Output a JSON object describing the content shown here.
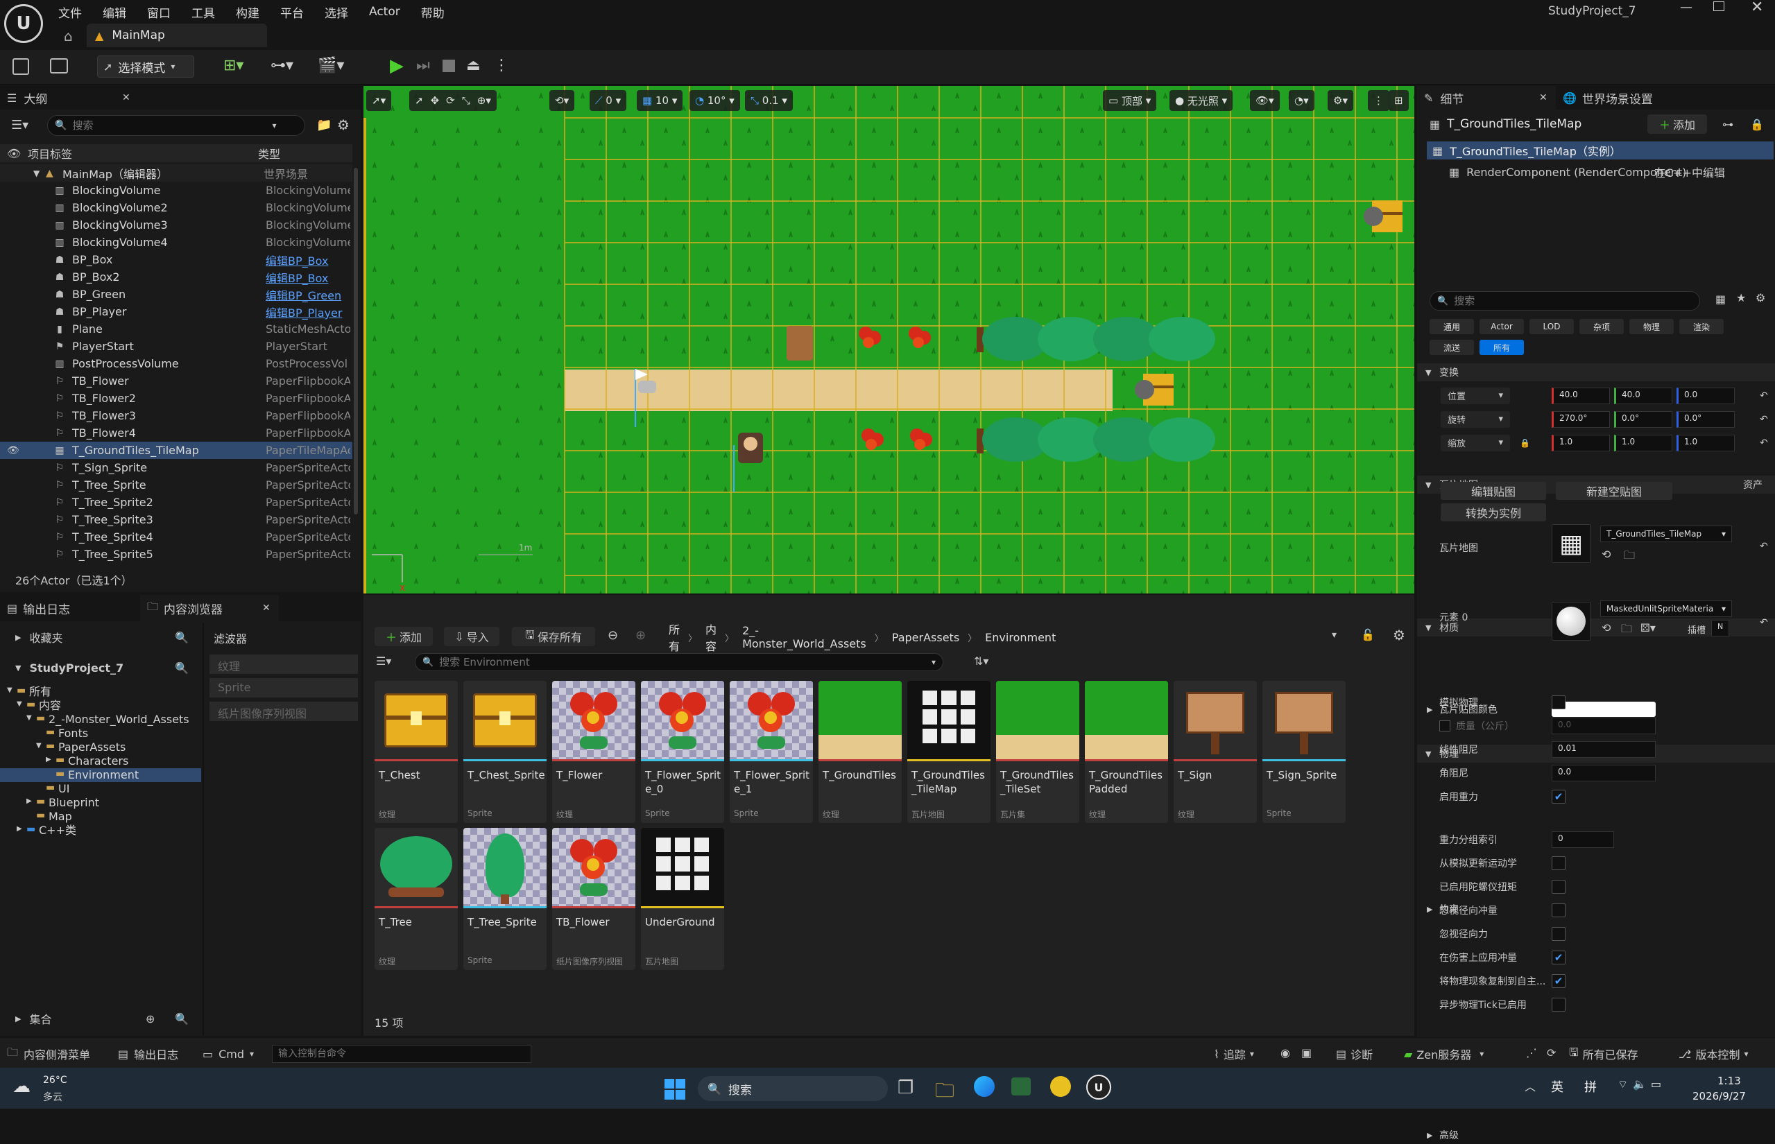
{
  "title_bar": {
    "menu": [
      "文件",
      "编辑",
      "窗口",
      "工具",
      "构建",
      "平台",
      "选择",
      "Actor",
      "帮助"
    ],
    "project_name": "StudyProject_7",
    "level_tab": "MainMap"
  },
  "toolbar": {
    "mode": "选择模式"
  },
  "outliner": {
    "tab": "大纲",
    "search_placeholder": "搜索",
    "col_label": "项目标签",
    "col_type": "类型",
    "root": {
      "label": "MainMap（编辑器）",
      "type": "世界场景"
    },
    "items": [
      {
        "label": "BlockingVolume",
        "type": "BlockingVolume",
        "link": false
      },
      {
        "label": "BlockingVolume2",
        "type": "BlockingVolume",
        "link": false
      },
      {
        "label": "BlockingVolume3",
        "type": "BlockingVolume",
        "link": false
      },
      {
        "label": "BlockingVolume4",
        "type": "BlockingVolume",
        "link": false
      },
      {
        "label": "BP_Box",
        "type": "编辑BP_Box",
        "link": true
      },
      {
        "label": "BP_Box2",
        "type": "编辑BP_Box",
        "link": true
      },
      {
        "label": "BP_Green",
        "type": "编辑BP_Green",
        "link": true
      },
      {
        "label": "BP_Player",
        "type": "编辑BP_Player",
        "link": true
      },
      {
        "label": "Plane",
        "type": "StaticMeshActo",
        "link": false
      },
      {
        "label": "PlayerStart",
        "type": "PlayerStart",
        "link": false
      },
      {
        "label": "PostProcessVolume",
        "type": "PostProcessVol",
        "link": false
      },
      {
        "label": "TB_Flower",
        "type": "PaperFlipbookA",
        "link": false
      },
      {
        "label": "TB_Flower2",
        "type": "PaperFlipbookA",
        "link": false
      },
      {
        "label": "TB_Flower3",
        "type": "PaperFlipbookA",
        "link": false
      },
      {
        "label": "TB_Flower4",
        "type": "PaperFlipbookA",
        "link": false
      },
      {
        "label": "T_GroundTiles_TileMap",
        "type": "PaperTileMapAc",
        "link": false
      },
      {
        "label": "T_Sign_Sprite",
        "type": "PaperSpriteActo",
        "link": false
      },
      {
        "label": "T_Tree_Sprite",
        "type": "PaperSpriteActo",
        "link": false
      },
      {
        "label": "T_Tree_Sprite2",
        "type": "PaperSpriteActo",
        "link": false
      },
      {
        "label": "T_Tree_Sprite3",
        "type": "PaperSpriteActo",
        "link": false
      },
      {
        "label": "T_Tree_Sprite4",
        "type": "PaperSpriteActo",
        "link": false
      },
      {
        "label": "T_Tree_Sprite5",
        "type": "PaperSpriteActo",
        "link": false
      }
    ],
    "footer": "26个Actor（已选1个）"
  },
  "viewport": {
    "snap_rot": "0",
    "grid": "10",
    "angle": "10°",
    "scale": "0.1",
    "view": "顶部",
    "lighting": "无光照",
    "scale_label": "1m"
  },
  "details": {
    "tab_details": "细节",
    "tab_world": "世界场景设置",
    "actor_name": "T_GroundTiles_TileMap",
    "add_label": "添加",
    "instance": "T_GroundTiles_TileMap（实例）",
    "component": "RenderComponent (RenderComponent)",
    "component_link": "在C++中编辑",
    "search_placeholder": "搜索",
    "filters": [
      "通用",
      "Actor",
      "LOD",
      "杂项",
      "物理",
      "渲染",
      "流送",
      "所有"
    ],
    "section_transform": "变换",
    "location_label": "位置",
    "rotation_label": "旋转",
    "scale_label": "缩放",
    "location": [
      "40.0",
      "40.0",
      "0.0"
    ],
    "rotation": [
      "270.0°",
      "0.0°",
      "0.0°"
    ],
    "scale": [
      "1.0",
      "1.0",
      "1.0"
    ],
    "section_tilemap": "瓦片地图",
    "asset_label": "资产",
    "btn_edit": "编辑贴图",
    "btn_new": "新建空贴图",
    "btn_convert": "转换为实例",
    "tilemap_label": "瓦片地图",
    "tilemap_value": "T_GroundTiles_TileMap",
    "section_material": "材质",
    "element0": "元素 0",
    "material_value": "MaskedUnlitSpriteMateria",
    "slot_label": "插槽",
    "slot_value": "N",
    "tile_color_label": "瓦片贴图颜色",
    "section_physics": "物理",
    "physics": [
      {
        "label": "模拟物理",
        "kind": "check",
        "checked": false
      },
      {
        "label": "质量（公斤）",
        "kind": "mass",
        "value": "0.0"
      },
      {
        "label": "线性阻尼",
        "kind": "num",
        "value": "0.01"
      },
      {
        "label": "角阻尼",
        "kind": "num",
        "value": "0.0"
      },
      {
        "label": "启用重力",
        "kind": "check",
        "checked": true
      }
    ],
    "section_constraints": "约束",
    "more": [
      {
        "label": "重力分组索引",
        "kind": "num",
        "value": "0"
      },
      {
        "label": "从模拟更新运动学",
        "kind": "check",
        "checked": false
      },
      {
        "label": "已启用陀螺仪扭矩",
        "kind": "check",
        "checked": false
      },
      {
        "label": "忽视径向冲量",
        "kind": "check",
        "checked": false
      },
      {
        "label": "忽视径向力",
        "kind": "check",
        "checked": false
      },
      {
        "label": "在伤害上应用冲量",
        "kind": "check",
        "checked": true
      },
      {
        "label": "将物理现象复制到自主...",
        "kind": "check",
        "checked": true
      },
      {
        "label": "异步物理Tick已启用",
        "kind": "check",
        "checked": false
      }
    ],
    "section_advanced": "高级"
  },
  "bottom_tabs": {
    "output_log": "输出日志",
    "content_browser": "内容浏览器"
  },
  "sources": {
    "favorites": "收藏夹",
    "project": "StudyProject_7",
    "tree": [
      {
        "label": "所有",
        "indent": 0
      },
      {
        "label": "内容",
        "indent": 1
      },
      {
        "label": "2_-Monster_World_Assets",
        "indent": 2
      },
      {
        "label": "Fonts",
        "indent": 3
      },
      {
        "label": "PaperAssets",
        "indent": 3
      },
      {
        "label": "Characters",
        "indent": 4
      },
      {
        "label": "Environment",
        "indent": 4
      },
      {
        "label": "UI",
        "indent": 3
      },
      {
        "label": "Blueprint",
        "indent": 2
      },
      {
        "label": "Map",
        "indent": 2
      },
      {
        "label": "C++类",
        "indent": 1
      }
    ],
    "collections": "集合",
    "filters_title": "滤波器",
    "filters": [
      "纹理",
      "Sprite",
      "纸片图像序列视图"
    ]
  },
  "content_browser": {
    "add": "添加",
    "import": "导入",
    "save_all": "保存所有",
    "path": [
      "所有",
      "内容",
      "2_-Monster_World_Assets",
      "PaperAssets",
      "Environment"
    ],
    "search_placeholder": "搜索 Environment",
    "count": "15 项",
    "assets": [
      {
        "name": "T_Chest",
        "type": "纹理",
        "thumb": "chest"
      },
      {
        "name": "T_Chest_Sprite",
        "type": "Sprite",
        "thumb": "chest"
      },
      {
        "name": "T_Flower",
        "type": "纹理",
        "thumb": "flower2"
      },
      {
        "name": "T_Flower_Sprite_0",
        "type": "Sprite",
        "thumb": "flower"
      },
      {
        "name": "T_Flower_Sprite_1",
        "type": "Sprite",
        "thumb": "flower"
      },
      {
        "name": "T_GroundTiles",
        "type": "纹理",
        "thumb": "ground"
      },
      {
        "name": "T_GroundTiles_TileMap",
        "type": "瓦片地图",
        "thumb": "grid"
      },
      {
        "name": "T_GroundTiles_TileSet",
        "type": "瓦片集",
        "thumb": "ground"
      },
      {
        "name": "T_GroundTiles Padded",
        "type": "纹理",
        "thumb": "ground"
      },
      {
        "name": "T_Sign",
        "type": "纹理",
        "thumb": "sign"
      },
      {
        "name": "T_Sign_Sprite",
        "type": "Sprite",
        "thumb": "sign"
      },
      {
        "name": "T_Tree",
        "type": "纹理",
        "thumb": "tree"
      },
      {
        "name": "T_Tree_Sprite",
        "type": "Sprite",
        "thumb": "tree2"
      },
      {
        "name": "TB_Flower",
        "type": "纸片图像序列视图",
        "thumb": "flower"
      },
      {
        "name": "UnderGround",
        "type": "瓦片地图",
        "thumb": "grid"
      }
    ]
  },
  "status_bar": {
    "drawer": "内容侧滑菜单",
    "output_log": "输出日志",
    "cmd": "Cmd",
    "cmd_placeholder": "输入控制台命令",
    "trace": "追踪",
    "diag": "诊断",
    "zen": "Zen服务器",
    "saved": "所有已保存",
    "vcs": "版本控制"
  },
  "taskbar": {
    "temp": "26°C",
    "weather": "多云",
    "search": "搜索",
    "ime1": "英",
    "ime2": "拼",
    "time": "1:13",
    "date": "2026/9/27"
  },
  "colors": {
    "accent": "#0070e0",
    "grass": "#1e8e1e",
    "grid": "#e0b020",
    "selected_row": "#2f4a6e",
    "link": "#5aa0ff"
  }
}
